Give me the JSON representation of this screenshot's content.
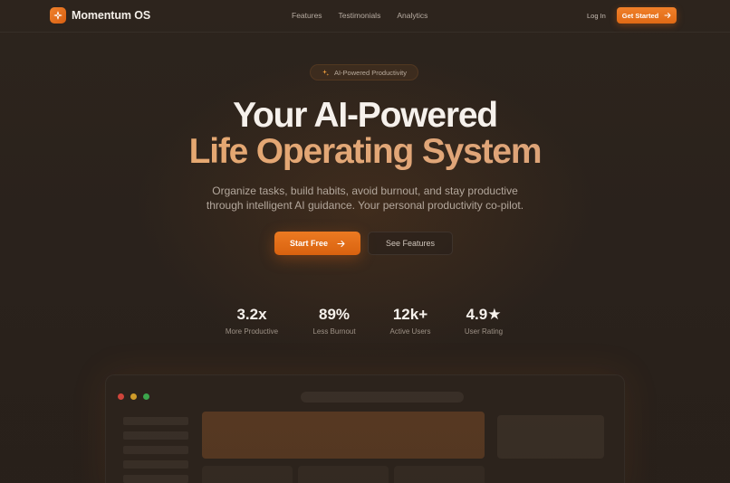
{
  "nav": {
    "brand": "Momentum OS",
    "links": [
      "Features",
      "Testimonials",
      "Analytics"
    ],
    "login": "Log In",
    "cta": "Get Started"
  },
  "hero": {
    "badge": "AI-Powered Productivity",
    "title_line1": "Your AI-Powered",
    "title_line2": "Life Operating System",
    "subtitle_line1": "Organize tasks, build habits, avoid burnout, and stay productive",
    "subtitle_line2": "through intelligent AI guidance. Your personal productivity co-pilot.",
    "primary_button": "Start Free",
    "secondary_button": "See Features"
  },
  "stats": [
    {
      "value": "3.2x",
      "label": "More Productive"
    },
    {
      "value": "89%",
      "label": "Less Burnout"
    },
    {
      "value": "12k+",
      "label": "Active Users"
    },
    {
      "value": "4.9★",
      "label": "User Rating"
    }
  ],
  "icons": {
    "brand_logo": "sparkle-icon",
    "badge_icon": "sparkles-icon",
    "cta_arrow": "arrow-right-icon"
  },
  "colors": {
    "accent": "#e8731c",
    "background": "#2a221c",
    "title_gradient": "#e6a672",
    "window_dot_red": "#d9473d",
    "window_dot_yellow": "#d9a22a",
    "window_dot_green": "#3dae4f"
  }
}
